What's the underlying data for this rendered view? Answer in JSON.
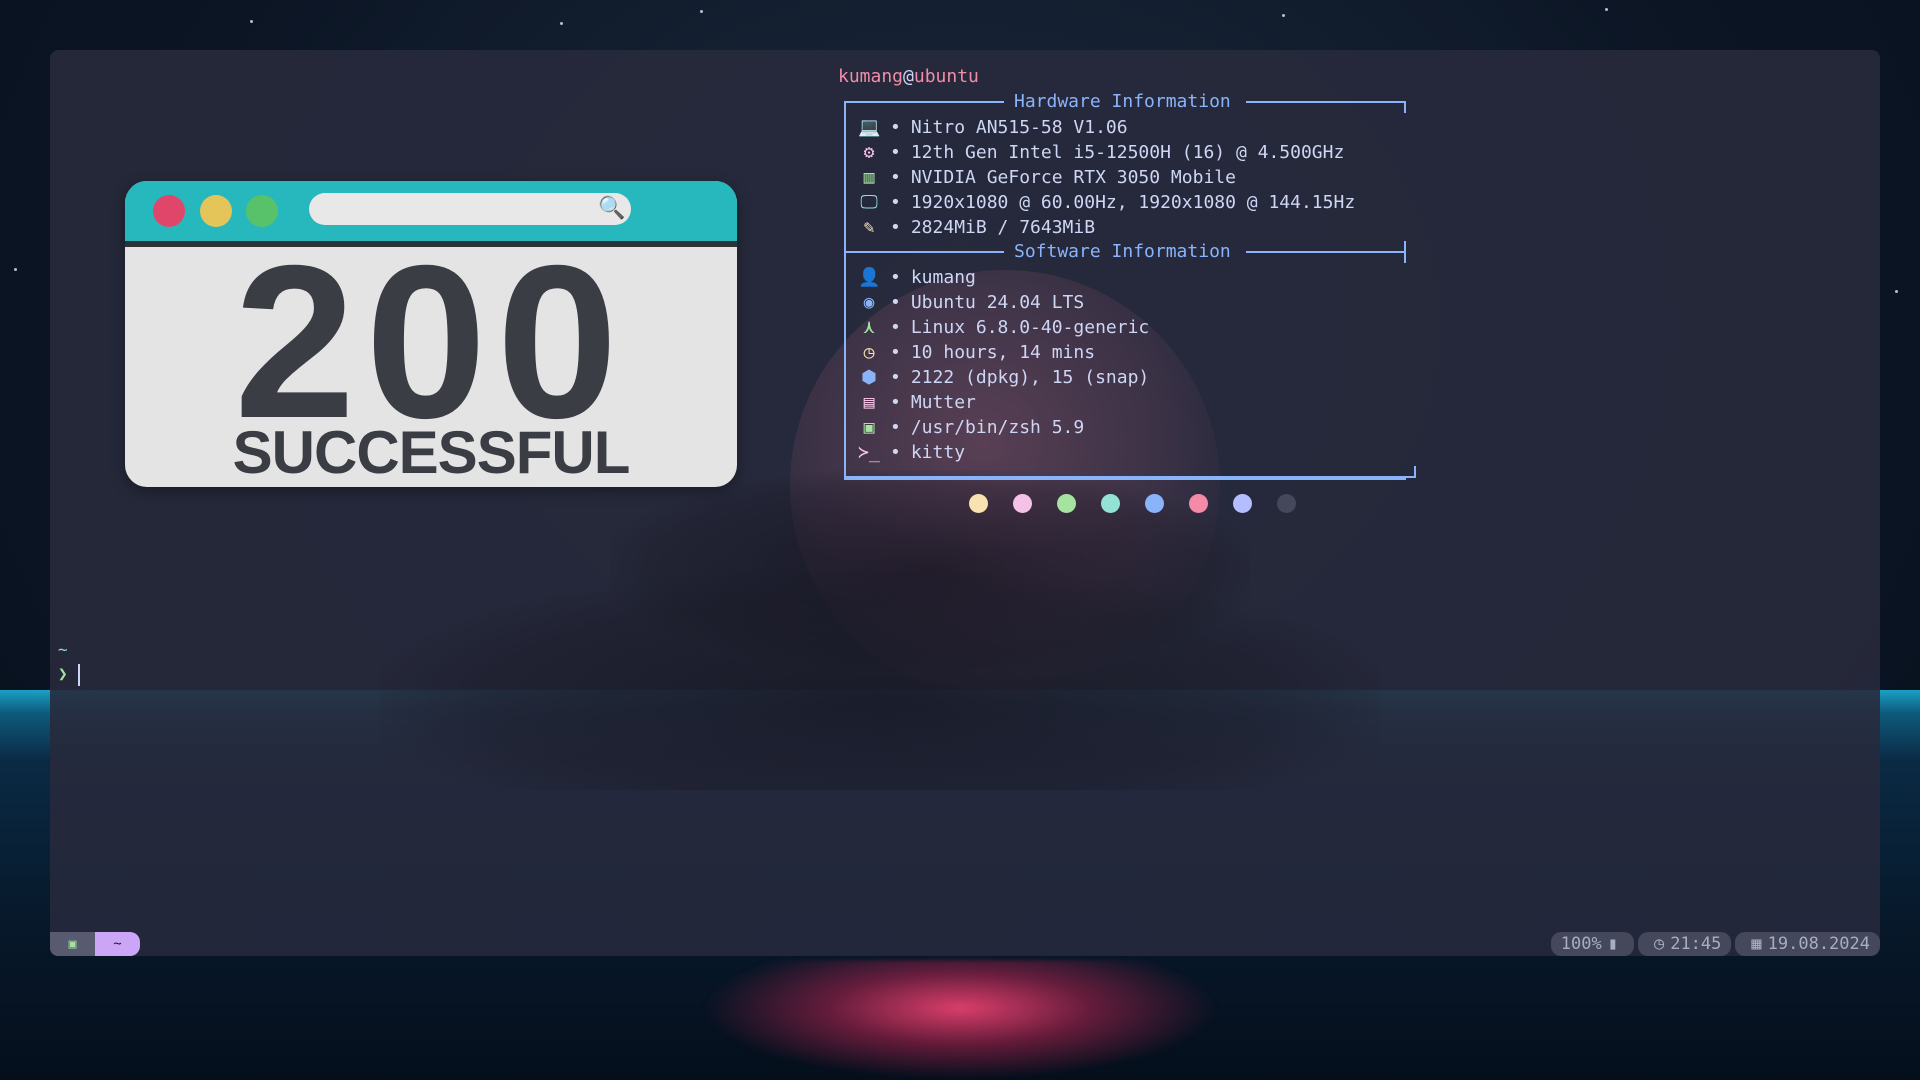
{
  "fetch": {
    "user": "kumang",
    "host": "ubuntu",
    "hardware_title": "Hardware Information",
    "software_title": "Software Information",
    "bullet": "•",
    "hardware": [
      {
        "icon_name": "laptop-icon",
        "glyph": "💻",
        "color": "#f9e2af",
        "value": "Nitro AN515-58 V1.06"
      },
      {
        "icon_name": "cpu-icon",
        "glyph": "⚙",
        "color": "#f5c2e7",
        "value": "12th Gen Intel i5-12500H (16) @ 4.500GHz"
      },
      {
        "icon_name": "gpu-icon",
        "glyph": "▥",
        "color": "#a6e3a1",
        "value": "NVIDIA GeForce RTX 3050 Mobile"
      },
      {
        "icon_name": "monitor-icon",
        "glyph": "🖵",
        "color": "#94e2d5",
        "value": "1920x1080 @ 60.00Hz, 1920x1080 @ 144.15Hz"
      },
      {
        "icon_name": "memory-icon",
        "glyph": "✎",
        "color": "#f9e2af",
        "value": "2824MiB / 7643MiB"
      }
    ],
    "software": [
      {
        "icon_name": "user-icon",
        "glyph": "👤",
        "color": "#f38ba8",
        "value": "kumang"
      },
      {
        "icon_name": "ubuntu-icon",
        "glyph": "◉",
        "color": "#89b4fa",
        "value": "Ubuntu 24.04 LTS"
      },
      {
        "icon_name": "kernel-icon",
        "glyph": "⋏",
        "color": "#a6e3a1",
        "value": "Linux 6.8.0-40-generic"
      },
      {
        "icon_name": "clock-icon",
        "glyph": "◷",
        "color": "#f9e2af",
        "value": "10 hours, 14 mins"
      },
      {
        "icon_name": "package-icon",
        "glyph": "⬢",
        "color": "#89b4fa",
        "value": "2122 (dpkg), 15 (snap)"
      },
      {
        "icon_name": "window-manager-icon",
        "glyph": "▤",
        "color": "#f5c2e7",
        "value": "Mutter"
      },
      {
        "icon_name": "shell-icon",
        "glyph": "▣",
        "color": "#a6e3a1",
        "value": "/usr/bin/zsh 5.9"
      },
      {
        "icon_name": "terminal-icon",
        "glyph": "≻_",
        "color": "#f5c2e7",
        "value": "kitty"
      }
    ],
    "palette": [
      "#f9e2af",
      "#f5c2e7",
      "#a6e3a1",
      "#94e2d5",
      "#89b4fa",
      "#f38ba8",
      "#b4befe",
      "#45475a"
    ]
  },
  "card": {
    "code": "200",
    "word": "SUCCESSFUL",
    "dot_colors": [
      "#e0466a",
      "#e3c55a",
      "#58c26a"
    ],
    "bar_color": "#27b8be"
  },
  "prompt": {
    "cwd": "~",
    "symbol": "❯"
  },
  "statusbar": {
    "tab_label": "~",
    "battery": "100%",
    "time": "21:45",
    "date": "19.08.2024"
  }
}
